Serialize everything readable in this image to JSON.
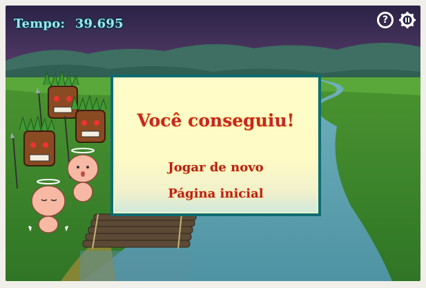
{
  "hud": {
    "timer_label": "Tempo:",
    "timer_value": "39.695",
    "help_icon": "?",
    "pause_icon": "pause-icon"
  },
  "dialog": {
    "title": "Você conseguiu!",
    "play_again": "Jogar de novo",
    "home_page": "Página inicial"
  },
  "colors": {
    "sky_top": "#2c2346",
    "sky_bottom": "#5b3e6a",
    "mountains": "#3a6f5e",
    "grass": "#3f8a2e",
    "river": "#5a9fae",
    "dialog_border": "#0e6b70",
    "dialog_text": "#c7252e",
    "timer_text": "#9ee7ef"
  }
}
